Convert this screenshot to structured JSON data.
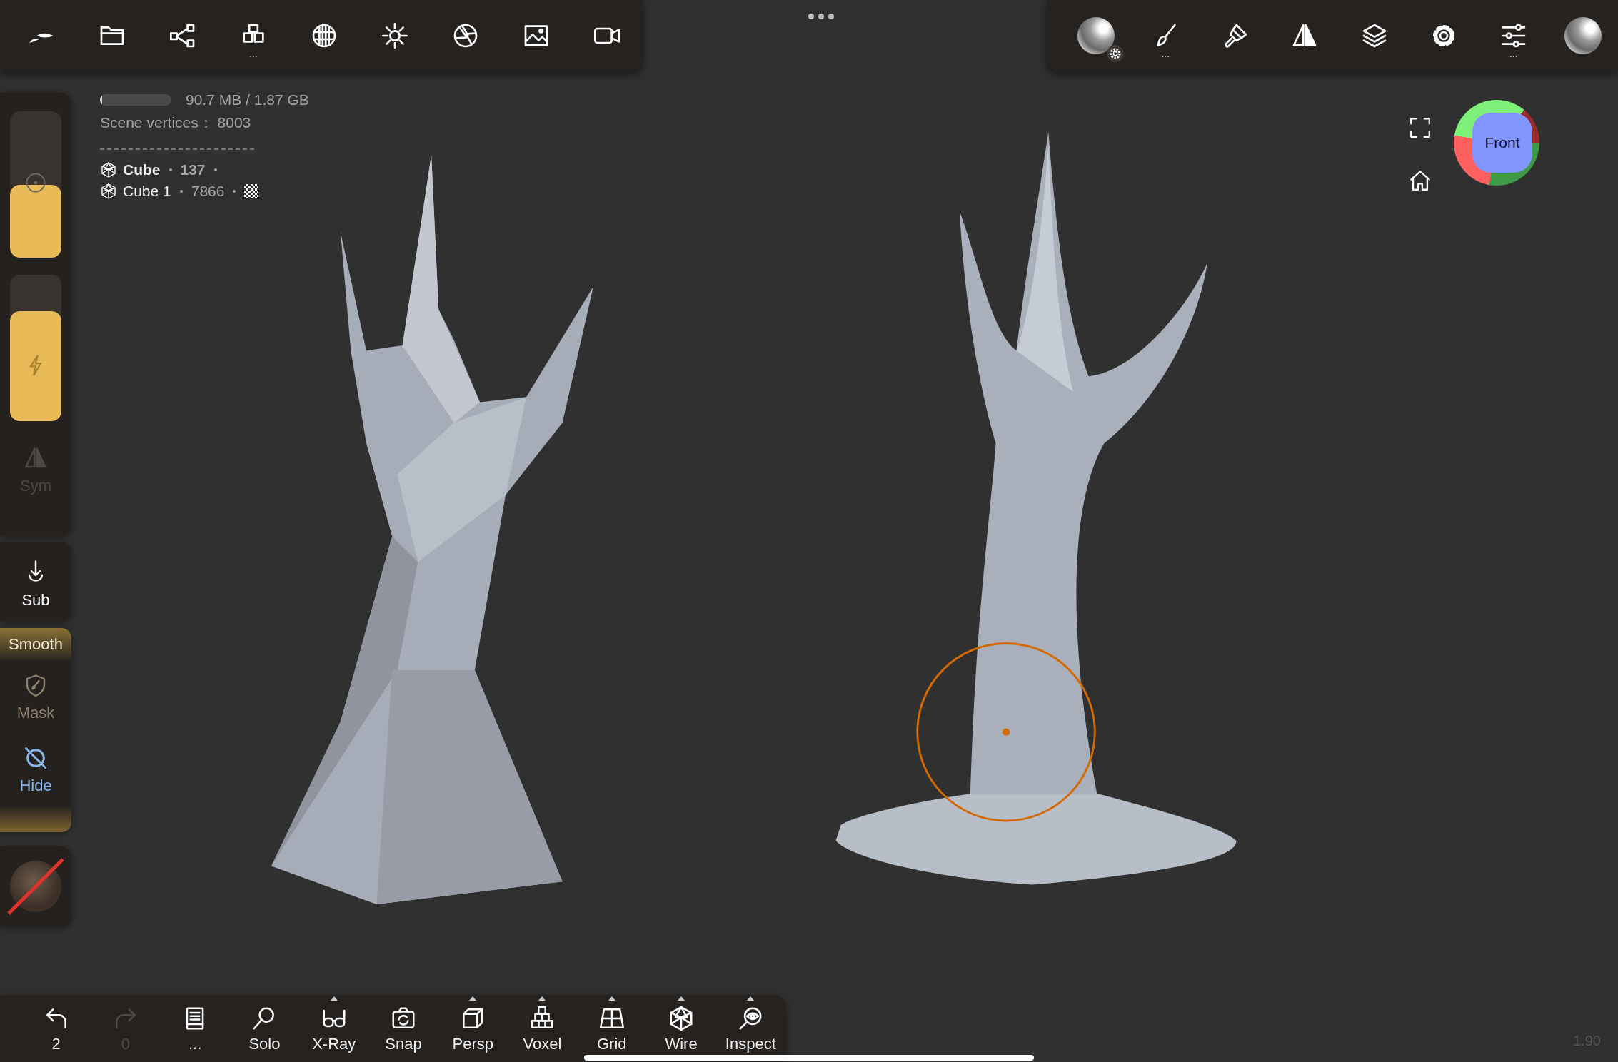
{
  "top_toolbar_left": {
    "items": [
      {
        "kind": "logo"
      },
      {
        "kind": "folder"
      },
      {
        "kind": "nodes"
      },
      {
        "kind": "cubes",
        "more": "..."
      },
      {
        "kind": "globe"
      },
      {
        "kind": "sun"
      },
      {
        "kind": "aperture"
      },
      {
        "kind": "image"
      },
      {
        "kind": "camera"
      }
    ]
  },
  "top_toolbar_right": {
    "items": [
      {
        "kind": "matcap",
        "badge": true
      },
      {
        "kind": "brush",
        "more": "..."
      },
      {
        "kind": "paintbrush"
      },
      {
        "kind": "symmetry"
      },
      {
        "kind": "layers"
      },
      {
        "kind": "gear"
      },
      {
        "kind": "sliders",
        "more": "..."
      },
      {
        "kind": "matcap",
        "badge": false
      }
    ]
  },
  "info": {
    "memory": {
      "level": 0.03,
      "text": "90.7 MB / 1.87 GB"
    },
    "vertices": "Scene vertices：  8003",
    "objects": [
      {
        "name": "Cube",
        "count": "137",
        "selected": true,
        "textured": false
      },
      {
        "name": "Cube 1",
        "count": "7866",
        "selected": false,
        "textured": true
      }
    ]
  },
  "left_panel": {
    "sliders": [
      {
        "kind": "radius",
        "level": 0.5
      },
      {
        "kind": "intensity",
        "level": 0.75
      }
    ],
    "symmetry": {
      "label": "Sym",
      "disabled": true
    },
    "sub": {
      "label": "Sub"
    },
    "tool_group": {
      "title": "Smooth",
      "tools": [
        {
          "kind": "mask",
          "label": "Mask",
          "selected": false
        },
        {
          "kind": "hide",
          "label": "Hide",
          "selected": true
        }
      ]
    }
  },
  "gizmo": {
    "label": "Front"
  },
  "bottom_toolbar": {
    "items": [
      {
        "kind": "undo",
        "label": "2",
        "disabled": false,
        "menu": false
      },
      {
        "kind": "redo",
        "label": "0",
        "disabled": true,
        "menu": false
      },
      {
        "kind": "book",
        "label": "...",
        "disabled": false,
        "menu": false
      },
      {
        "kind": "search",
        "label": "Solo",
        "disabled": false,
        "menu": false
      },
      {
        "kind": "glasses",
        "label": "X-Ray",
        "disabled": false,
        "menu": true
      },
      {
        "kind": "snap",
        "label": "Snap",
        "disabled": false,
        "menu": false
      },
      {
        "kind": "cube",
        "label": "Persp",
        "disabled": false,
        "menu": true
      },
      {
        "kind": "voxel",
        "label": "Voxel",
        "disabled": false,
        "menu": true
      },
      {
        "kind": "grid",
        "label": "Grid",
        "disabled": false,
        "menu": true
      },
      {
        "kind": "wire",
        "label": "Wire",
        "disabled": false,
        "menu": true
      },
      {
        "kind": "inspect",
        "label": "Inspect",
        "disabled": false,
        "menu": true
      }
    ]
  },
  "version": "1.90"
}
